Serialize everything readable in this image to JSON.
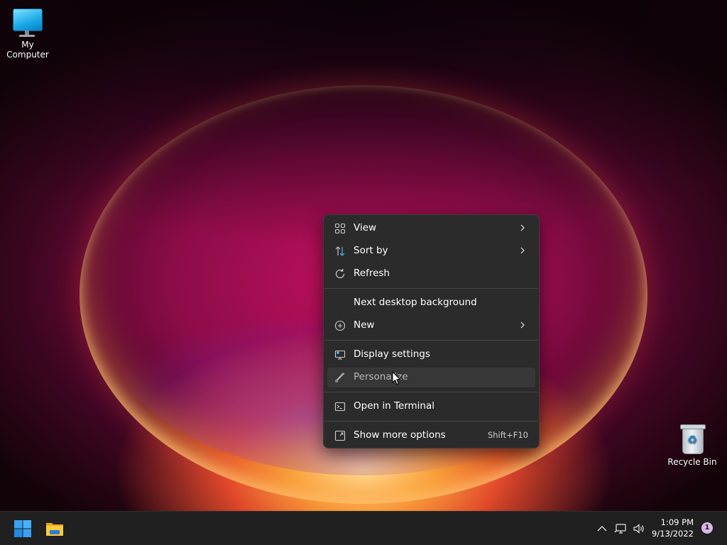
{
  "desktop": {
    "icons": [
      {
        "label": "My Computer",
        "icon": "monitor-icon"
      },
      {
        "label": "Recycle Bin",
        "icon": "recycle-bin-icon"
      }
    ]
  },
  "context_menu": {
    "items": [
      {
        "label": "View",
        "icon": "grid-icon",
        "has_submenu": true
      },
      {
        "label": "Sort by",
        "icon": "sort-arrows-icon",
        "has_submenu": true
      },
      {
        "label": "Refresh",
        "icon": "refresh-icon",
        "has_submenu": false
      },
      {
        "label": "Next desktop background",
        "icon": "",
        "has_submenu": false
      },
      {
        "label": "New",
        "icon": "plus-circle-icon",
        "has_submenu": true
      },
      {
        "label": "Display settings",
        "icon": "display-icon",
        "has_submenu": false
      },
      {
        "label": "Personalize",
        "icon": "brush-icon",
        "has_submenu": false,
        "hovered": true
      },
      {
        "label": "Open in Terminal",
        "icon": "terminal-icon",
        "has_submenu": false
      },
      {
        "label": "Show more options",
        "icon": "expand-icon",
        "shortcut": "Shift+F10"
      }
    ]
  },
  "taskbar": {
    "start_icon": "windows-start-icon",
    "pinned": [
      {
        "icon": "file-explorer-icon"
      }
    ],
    "tray": {
      "overflow_icon": "chevron-up-icon",
      "network_icon": "network-icon",
      "volume_icon": "volume-icon",
      "time": "1:09 PM",
      "date": "9/13/2022",
      "notification_count": "1"
    }
  },
  "colors": {
    "menu_bg": "#2b2b2b",
    "taskbar_bg": "#202020",
    "accent": "#0078d4",
    "notification_badge": "#d8b7ea"
  }
}
